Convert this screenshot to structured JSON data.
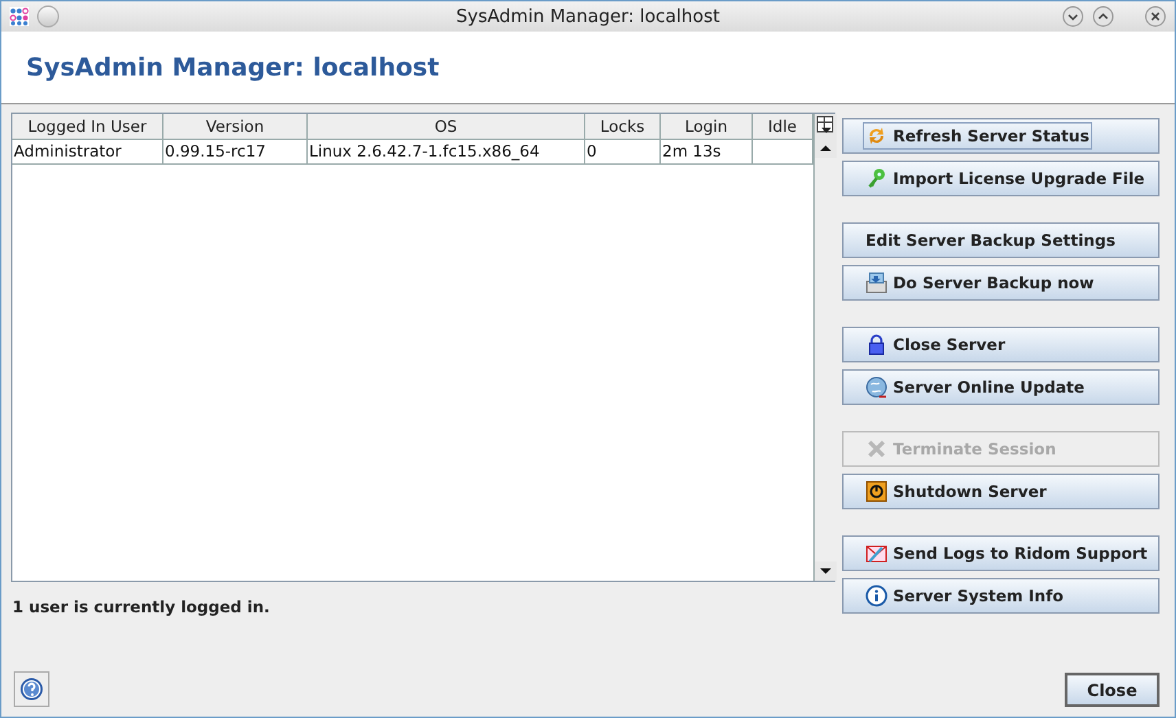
{
  "window": {
    "title": "SysAdmin Manager: localhost"
  },
  "header": {
    "title": "SysAdmin Manager: localhost"
  },
  "table": {
    "columns": [
      "Logged In User",
      "Version",
      "OS",
      "Locks",
      "Login",
      "Idle"
    ],
    "rows": [
      [
        "Administrator",
        "0.99.15-rc17",
        "Linux 2.6.42.7-1.fc15.x86_64",
        "0",
        "2m 13s",
        ""
      ]
    ]
  },
  "button_groups": [
    [
      {
        "label": "Refresh Server Status",
        "kind": "refresh",
        "disabled": false,
        "focused": true
      },
      {
        "label": "Import License Upgrade File",
        "kind": "key",
        "disabled": false,
        "focused": false
      }
    ],
    [
      {
        "label": "Edit Server Backup Settings",
        "kind": "plain",
        "disabled": false,
        "focused": false
      },
      {
        "label": "Do Server Backup now",
        "kind": "backup",
        "disabled": false,
        "focused": false
      }
    ],
    [
      {
        "label": "Close Server",
        "kind": "lock",
        "disabled": false,
        "focused": false
      },
      {
        "label": "Server Online Update",
        "kind": "globe",
        "disabled": false,
        "focused": false
      }
    ],
    [
      {
        "label": "Terminate Session",
        "kind": "cross",
        "disabled": true,
        "focused": false
      },
      {
        "label": "Shutdown Server",
        "kind": "power",
        "disabled": false,
        "focused": false
      }
    ],
    [
      {
        "label": "Send Logs to Ridom Support",
        "kind": "mail",
        "disabled": false,
        "focused": false
      },
      {
        "label": "Server System Info",
        "kind": "info",
        "disabled": false,
        "focused": false
      }
    ]
  ],
  "status": "1 user is currently logged in.",
  "close_button": "Close"
}
